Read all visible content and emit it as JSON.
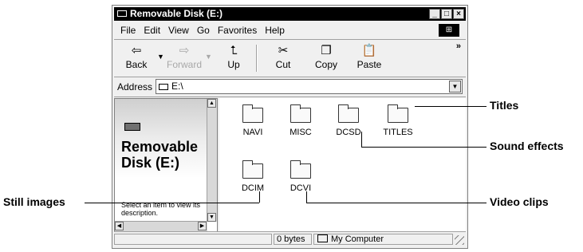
{
  "window": {
    "title": "Removable Disk (E:)",
    "controls": [
      "_",
      "□",
      "×"
    ]
  },
  "menu": [
    "File",
    "Edit",
    "View",
    "Go",
    "Favorites",
    "Help"
  ],
  "toolbar": {
    "back": "Back",
    "forward": "Forward",
    "up": "Up",
    "cut": "Cut",
    "copy": "Copy",
    "paste": "Paste",
    "more": "»"
  },
  "address": {
    "label": "Address",
    "value": "E:\\"
  },
  "left_pane": {
    "title_line1": "Removable",
    "title_line2": "Disk (E:)",
    "description": "Select an item to view its description."
  },
  "folders": [
    "NAVI",
    "MISC",
    "DCSD",
    "TITLES",
    "DCIM",
    "DCVI"
  ],
  "status": {
    "size": "0 bytes",
    "zone": "My Computer"
  },
  "callouts": {
    "titles": "Titles",
    "sound_effects": "Sound effects",
    "still_images": "Still images",
    "video_clips": "Video clips"
  }
}
